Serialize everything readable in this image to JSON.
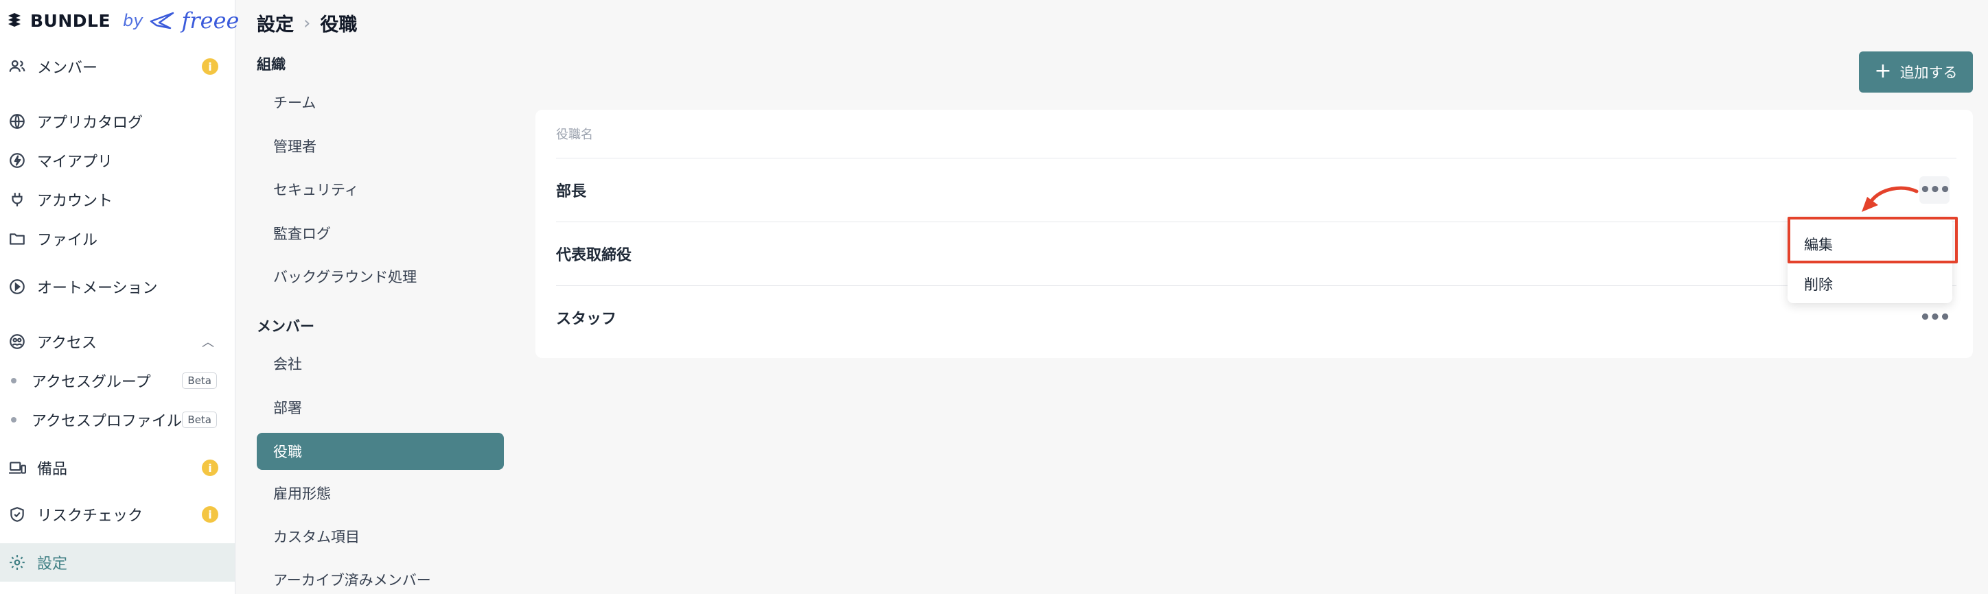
{
  "brand": {
    "name": "BUNDLE",
    "by": "by",
    "partner": "freee"
  },
  "sidebar": {
    "items": [
      {
        "label": "メンバー",
        "icon": "people-icon",
        "info": "i"
      },
      {
        "label": "アプリカタログ",
        "icon": "globe-icon"
      },
      {
        "label": "マイアプリ",
        "icon": "bolt-icon"
      },
      {
        "label": "アカウント",
        "icon": "plug-icon"
      },
      {
        "label": "ファイル",
        "icon": "folder-icon"
      },
      {
        "label": "オートメーション",
        "icon": "play-circle-icon"
      },
      {
        "label": "アクセス",
        "icon": "access-icon"
      },
      {
        "label": "備品",
        "icon": "devices-icon",
        "info": "i"
      },
      {
        "label": "リスクチェック",
        "icon": "shield-check-icon",
        "info": "i"
      },
      {
        "label": "設定",
        "icon": "gear-icon"
      }
    ],
    "access_sub": [
      {
        "label": "アクセスグループ",
        "badge": "Beta"
      },
      {
        "label": "アクセスプロファイル",
        "badge": "Beta"
      }
    ]
  },
  "breadcrumb": {
    "parent": "設定",
    "current": "役職"
  },
  "settings_menu": {
    "section1": "組織",
    "section1_items": [
      "チーム",
      "管理者",
      "セキュリティ",
      "監査ログ",
      "バックグラウンド処理"
    ],
    "section2": "メンバー",
    "section2_items": [
      "会社",
      "部署",
      "役職",
      "雇用形態",
      "カスタム項目",
      "アーカイブ済みメンバー"
    ]
  },
  "toolbar": {
    "add_label": "追加する"
  },
  "table": {
    "header": "役職名",
    "rows": [
      "部長",
      "代表取締役",
      "スタッフ"
    ]
  },
  "row_menu": {
    "edit": "編集",
    "delete": "削除"
  },
  "colors": {
    "accent": "#4a8289",
    "highlight": "#e4422b",
    "info": "#f4c542"
  }
}
